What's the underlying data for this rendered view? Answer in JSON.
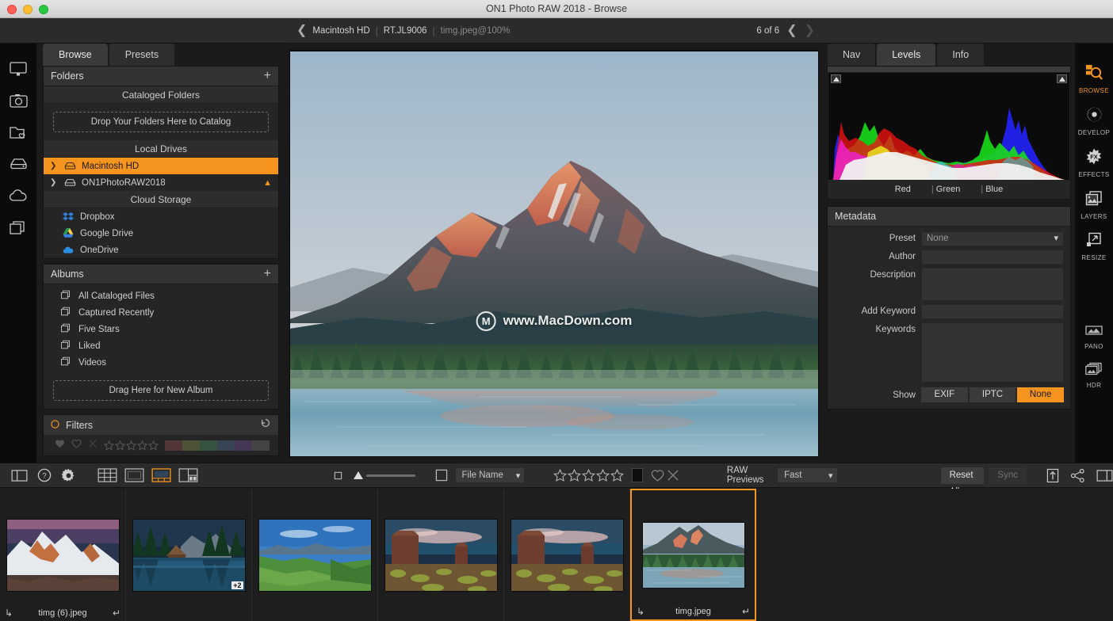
{
  "window": {
    "title": "ON1 Photo RAW 2018 - Browse"
  },
  "topbar": {
    "back_icon": "chevron-left-icon",
    "breadcrumbs": [
      {
        "label": "Macintosh HD",
        "dim": false
      },
      {
        "label": "RT.JL9006",
        "dim": false
      },
      {
        "label": "timg.jpeg@100%",
        "dim": true
      }
    ],
    "pager_text": "6 of 6",
    "prev_icon": "chevron-left-icon",
    "next_icon": "chevron-right-icon"
  },
  "left_rail": {
    "items": [
      {
        "icon": "monitor-icon",
        "name": "desktop"
      },
      {
        "icon": "camera-icon",
        "name": "camera"
      },
      {
        "icon": "folder-heart-icon",
        "name": "favorites"
      },
      {
        "icon": "drive-icon",
        "name": "drives"
      },
      {
        "icon": "cloud-icon",
        "name": "cloud"
      },
      {
        "icon": "albums-icon",
        "name": "albums"
      }
    ]
  },
  "left_panel": {
    "tabs": [
      {
        "label": "Browse",
        "active": true
      },
      {
        "label": "Presets",
        "active": false
      }
    ],
    "folders": {
      "title": "Folders",
      "add_icon": "plus-icon",
      "cataloged_header": "Cataloged Folders",
      "dropzone_label": "Drop Your Folders Here to Catalog",
      "local_header": "Local Drives",
      "drives": [
        {
          "label": "Macintosh HD",
          "selected": true,
          "eject": false
        },
        {
          "label": "ON1PhotoRAW2018",
          "selected": false,
          "eject": true
        }
      ],
      "cloud_header": "Cloud Storage",
      "cloud": [
        {
          "label": "Dropbox",
          "color": "#2e7dd6"
        },
        {
          "label": "Google Drive",
          "color": "#3ec16c"
        },
        {
          "label": "OneDrive",
          "color": "#2a8fe0"
        }
      ]
    },
    "albums": {
      "title": "Albums",
      "add_icon": "plus-icon",
      "items": [
        {
          "label": "All Cataloged Files"
        },
        {
          "label": "Captured Recently"
        },
        {
          "label": "Five Stars"
        },
        {
          "label": "Liked"
        },
        {
          "label": "Videos"
        }
      ],
      "dropzone_label": "Drag Here for New Album"
    },
    "filters": {
      "title": "Filters",
      "reset_icon": "reset-arrow-icon",
      "status_icon": "circle-icon",
      "swatch_colors": [
        "#8b4b4b",
        "#7d8b4b",
        "#4b8b60",
        "#4b6a8b",
        "#6d4b8b",
        "#6a6a6a"
      ]
    }
  },
  "preview": {
    "watermark_mark": "M",
    "watermark_text": "www.MacDown.com"
  },
  "right_panel": {
    "tabs": [
      {
        "label": "Nav",
        "active": false
      },
      {
        "label": "Levels",
        "active": true
      },
      {
        "label": "Info",
        "active": false
      }
    ],
    "histogram": {
      "channels": [
        "Red",
        "Green",
        "Blue"
      ]
    },
    "metadata": {
      "title": "Metadata",
      "preset_label": "Preset",
      "preset_value": "None",
      "author_label": "Author",
      "author_value": "",
      "description_label": "Description",
      "description_value": "",
      "add_keyword_label": "Add Keyword",
      "add_keyword_value": "",
      "keywords_label": "Keywords",
      "keywords_value": "",
      "show_label": "Show",
      "show_buttons": [
        {
          "label": "EXIF",
          "active": false
        },
        {
          "label": "IPTC",
          "active": false
        },
        {
          "label": "None",
          "active": true
        }
      ]
    }
  },
  "right_rail": {
    "modules": [
      {
        "label": "BROWSE",
        "icon": "browse-icon",
        "active": true
      },
      {
        "label": "DEVELOP",
        "icon": "aperture-icon",
        "active": false
      },
      {
        "label": "EFFECTS",
        "icon": "fx-burst-icon",
        "active": false
      },
      {
        "label": "LAYERS",
        "icon": "layers-icon",
        "active": false
      },
      {
        "label": "RESIZE",
        "icon": "resize-icon",
        "active": false
      }
    ],
    "extras": [
      {
        "label": "PANO",
        "icon": "panorama-icon"
      },
      {
        "label": "HDR",
        "icon": "hdr-icon"
      }
    ]
  },
  "toolbar": {
    "panel_toggle_icon": "panel-left-icon",
    "help_icon": "question-circle-icon",
    "settings_icon": "gear-icon",
    "view_modes": [
      {
        "icon": "grid-view-icon",
        "active": false
      },
      {
        "icon": "single-view-icon",
        "active": false
      },
      {
        "icon": "filmstrip-view-icon",
        "active": true
      },
      {
        "icon": "compare-view-icon",
        "active": false
      }
    ],
    "thumb_small_icon": "small-square-icon",
    "thumb_size_slider": 0,
    "thumb_large_icon": "large-square-icon",
    "sort_label": "File Name",
    "sort_caret_icon": "chevron-down-icon",
    "rating_stars": 5,
    "color_label_swatch": "#0e0e0e",
    "like_icon": "heart-icon",
    "reject_icon": "x-icon",
    "raw_previews_label": "RAW Previews",
    "raw_previews_value": "Fast",
    "reset_all_label": "Reset All",
    "sync_label": "Sync",
    "share_icon": "share-up-icon",
    "sendto_icon": "share-node-icon",
    "layout_icon": "panel-right-icon"
  },
  "filmstrip": {
    "items": [
      {
        "caption": "timg (6).jpeg",
        "selected": false,
        "badge": "",
        "scene": "peaks"
      },
      {
        "caption": "",
        "selected": false,
        "badge": "+2",
        "scene": "cabin"
      },
      {
        "caption": "",
        "selected": false,
        "badge": "",
        "scene": "valley"
      },
      {
        "caption": "",
        "selected": false,
        "badge": "",
        "scene": "mesa"
      },
      {
        "caption": "",
        "selected": false,
        "badge": "",
        "scene": "mesa"
      },
      {
        "caption": "timg.jpeg",
        "selected": true,
        "badge": "",
        "scene": "lake"
      }
    ],
    "corner_left_icon": "rotate-left-icon",
    "corner_right_icon": "rotate-right-icon"
  },
  "colors": {
    "accent": "#f5941e",
    "panel_bg": "#252525",
    "app_bg": "#1b1b1b",
    "text": "#cfcfcf"
  }
}
